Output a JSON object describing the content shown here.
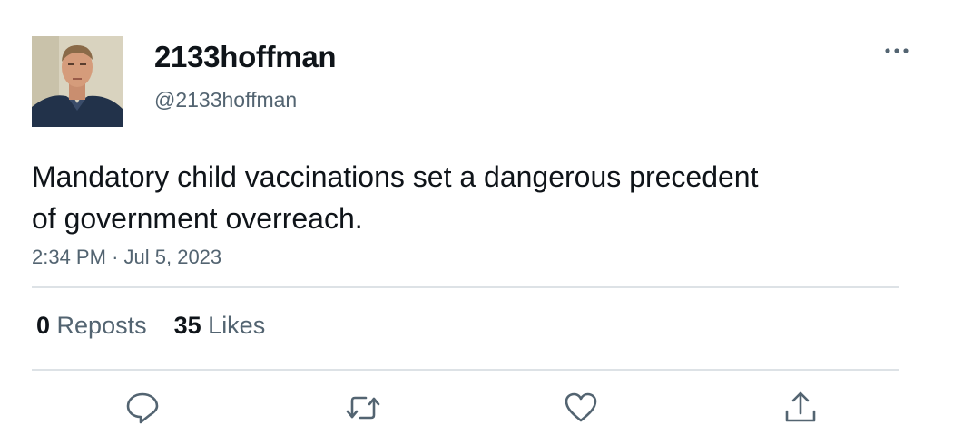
{
  "user": {
    "display_name": "2133hoffman",
    "handle": "@2133hoffman"
  },
  "tweet": {
    "text_line1": "Mandatory child vaccinations set a dangerous precedent",
    "text_line2": "of government overreach.",
    "time": "2:34 PM",
    "separator": "·",
    "date": "Jul 5, 2023"
  },
  "stats": {
    "reposts_count": "0",
    "reposts_label": "Reposts",
    "likes_count": "35",
    "likes_label": "Likes"
  },
  "icons": {
    "more": "more-horizontal-icon",
    "reply": "reply-icon",
    "repost": "repost-icon",
    "like": "heart-icon",
    "share": "share-icon"
  },
  "colors": {
    "text_primary": "#0f1419",
    "text_secondary": "#536471",
    "divider": "#dde2e6",
    "icon": "#536471"
  }
}
